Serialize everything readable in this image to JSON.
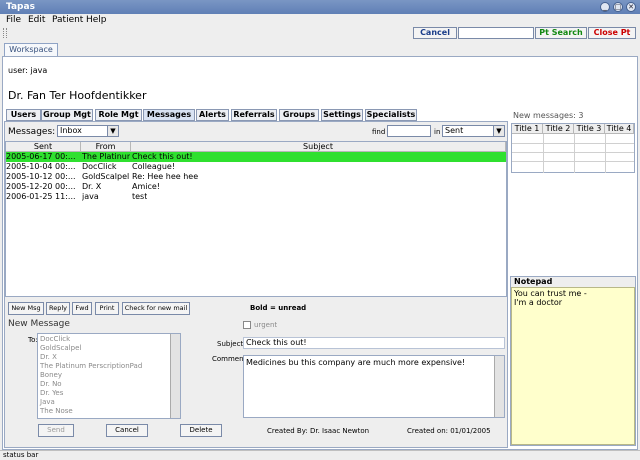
{
  "window": {
    "title": "Tapas"
  },
  "menu": [
    "File",
    "Edit",
    "Patient",
    "Help"
  ],
  "toolbar": {
    "cancel": "Cancel",
    "pt_search": "Pt Search",
    "close_pt": "Close Pt"
  },
  "workspace_tab": "Workspace",
  "user_line": "user: java",
  "doctor_name": "Dr. Fan Ter Hoofdentikker",
  "tabs": [
    "Users",
    "Group Mgt",
    "Role Mgt",
    "Messages",
    "Alerts",
    "Referrals",
    "Groups",
    "Settings",
    "Specialists"
  ],
  "active_tab": "Messages",
  "messages": {
    "label": "Messages:",
    "folder": "Inbox",
    "find_label": "find",
    "in_label": "in",
    "in_folder": "Sent",
    "columns": [
      "Sent",
      "From",
      "Subject"
    ],
    "rows": [
      {
        "sent": "2005-06-17 00:...",
        "from": "The Platinum ...",
        "subject": "Check this out!",
        "selected": true
      },
      {
        "sent": "2005-10-04 00:...",
        "from": "DocClick",
        "subject": "Colleague!"
      },
      {
        "sent": "2005-10-12 00:...",
        "from": "GoldScalpel",
        "subject": "Re: Hee hee hee"
      },
      {
        "sent": "2005-12-20 00:...",
        "from": "Dr. X",
        "subject": "Amice!"
      },
      {
        "sent": "2006-01-25 11:...",
        "from": "java",
        "subject": "test"
      }
    ],
    "buttons": {
      "new_msg": "New Msg",
      "reply": "Reply",
      "fwd": "Fwd",
      "print": "Print",
      "check_mail": "Check for new mail"
    },
    "bold_note": "Bold = unread"
  },
  "new_message": {
    "title": "New Message",
    "to_label": "To:",
    "recipients": [
      "DocClick",
      "GoldScalpel",
      "Dr. X",
      "The Platinum PerscriptionPad",
      "Boney",
      "Dr. No",
      "Dr. Yes",
      "Java",
      "The Nose"
    ],
    "urgent_label": "urgent",
    "subject_label": "Subject",
    "subject_value": "Check this out!",
    "comment_label": "Comment",
    "comment_value": "Medicines bu this company are much more expensive!",
    "send": "Send",
    "cancel": "Cancel",
    "delete": "Delete",
    "created_by": "Created By: Dr. Isaac Newton",
    "created_on": "Created on: 01/01/2005"
  },
  "side": {
    "new_messages": "New messages: 3",
    "grid_titles": [
      "Title 1",
      "Title 2",
      "Title 3",
      "Title 4"
    ],
    "notepad_title": "Notepad",
    "notepad_lines": [
      "You can trust me -",
      "I'm a doctor"
    ]
  },
  "status_bar": "status bar",
  "colors": {
    "title_bar": "#6886bd",
    "selected_row": "#2fe02f",
    "pt_search_text": "#118811",
    "close_pt_text": "#cc0000",
    "notepad_bg": "#ffffcc"
  }
}
